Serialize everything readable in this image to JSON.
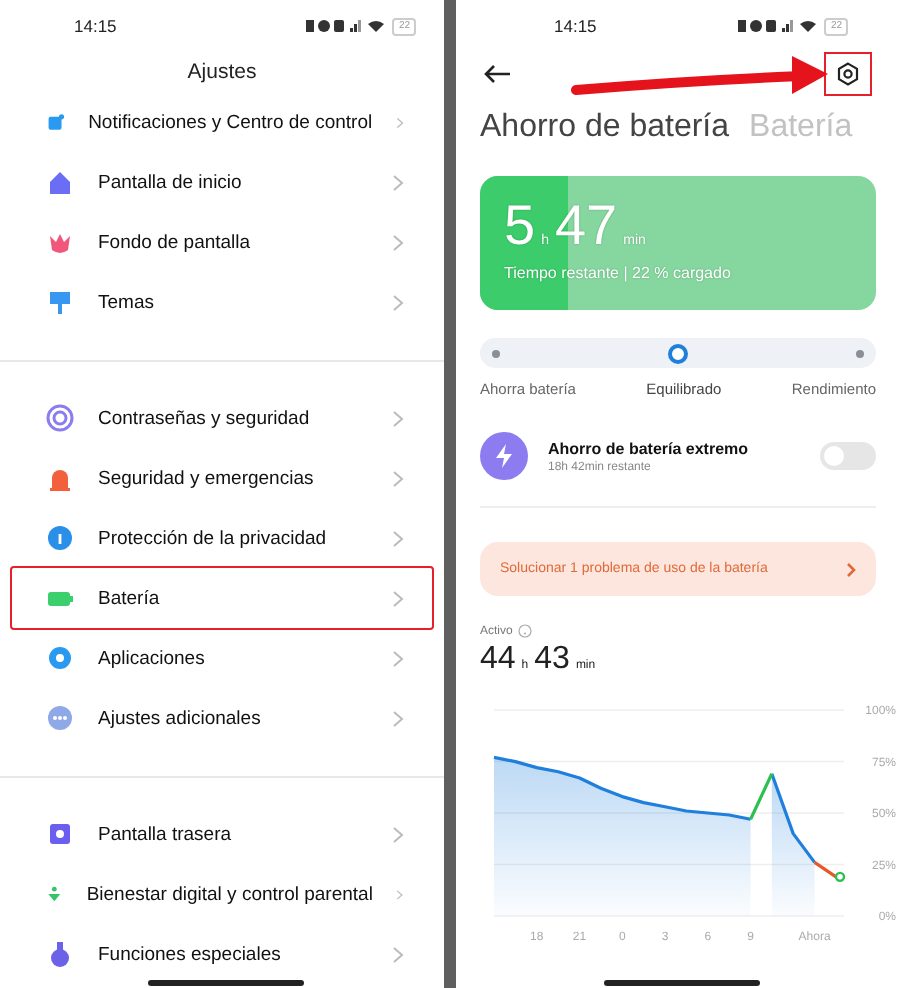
{
  "settings_screen": {
    "status_bar": {
      "time": "14:15",
      "battery": "22"
    },
    "title": "Ajustes",
    "sections": [
      {
        "items": [
          {
            "label": "Notificaciones y Centro de control",
            "highlighted": false
          },
          {
            "label": "Pantalla de inicio",
            "highlighted": false
          },
          {
            "label": "Fondo de pantalla",
            "highlighted": false
          },
          {
            "label": "Temas",
            "highlighted": false
          }
        ]
      },
      {
        "items": [
          {
            "label": "Contraseñas y seguridad",
            "highlighted": false
          },
          {
            "label": "Seguridad y emergencias",
            "highlighted": false
          },
          {
            "label": "Protección de la privacidad",
            "highlighted": false
          },
          {
            "label": "Batería",
            "highlighted": true
          },
          {
            "label": "Aplicaciones",
            "highlighted": false
          },
          {
            "label": "Ajustes adicionales",
            "highlighted": false
          }
        ]
      },
      {
        "items": [
          {
            "label": "Pantalla trasera",
            "highlighted": false
          },
          {
            "label": "Bienestar digital y control parental",
            "highlighted": false
          },
          {
            "label": "Funciones especiales",
            "highlighted": false
          }
        ]
      }
    ]
  },
  "battery_screen": {
    "status_bar": {
      "time": "14:15",
      "battery": "22"
    },
    "settings_button": {
      "highlighted": true
    },
    "tabs": [
      {
        "label": "Ahorro de batería",
        "selected": true
      },
      {
        "label": "Batería",
        "selected": false
      }
    ],
    "summary": {
      "hours": "5",
      "hours_unit": "h",
      "minutes": "47",
      "minutes_unit": "min",
      "caption": "Tiempo restante | 22 % cargado",
      "level": 0.22
    },
    "modes": [
      {
        "label": "Ahorra batería",
        "selected": false
      },
      {
        "label": "Equilibrado",
        "selected": true
      },
      {
        "label": "Rendimiento",
        "selected": false
      }
    ],
    "extreme_saver": {
      "title": "Ahorro de batería extremo",
      "subtitle": "18h 42min restante",
      "on": false
    },
    "banner": {
      "text": "Solucionar 1 problema de uso de la batería"
    },
    "active": {
      "label": "Activo",
      "hours": "44",
      "hours_unit": "h",
      "minutes": "43",
      "minutes_unit": "min"
    },
    "chart_data": {
      "type": "line",
      "grid": true,
      "categories": [
        null,
        null,
        "18",
        null,
        "21",
        null,
        "0",
        null,
        "3",
        null,
        "6",
        null,
        "9",
        null,
        null,
        "Ahora",
        null
      ],
      "series": [
        {
          "type": "area",
          "color": "#1f7fdc",
          "values": [
            77,
            75,
            72,
            70,
            67,
            62,
            58,
            55,
            53,
            51,
            50,
            49,
            47,
            null,
            null,
            null,
            null
          ]
        },
        {
          "type": "area",
          "color": "#1f7fdc",
          "values": [
            null,
            null,
            null,
            null,
            null,
            null,
            null,
            null,
            null,
            null,
            null,
            null,
            null,
            69,
            40,
            26,
            null
          ]
        },
        {
          "type": "line",
          "color": "#2ec04f",
          "values": [
            null,
            null,
            null,
            null,
            null,
            null,
            null,
            null,
            null,
            null,
            null,
            null,
            47,
            69,
            null,
            null,
            null
          ]
        },
        {
          "type": "line",
          "color": "#e8572a",
          "values": [
            null,
            null,
            null,
            null,
            null,
            null,
            null,
            null,
            null,
            null,
            null,
            null,
            null,
            null,
            null,
            26,
            19
          ]
        }
      ],
      "ylim": [
        0,
        100
      ],
      "yticks": [
        {
          "value": 100,
          "label": "100%"
        },
        {
          "value": 75,
          "label": "75%"
        },
        {
          "value": 50,
          "label": "50%"
        },
        {
          "value": 25,
          "label": "25%"
        },
        {
          "value": 0,
          "label": "0%"
        }
      ]
    }
  }
}
